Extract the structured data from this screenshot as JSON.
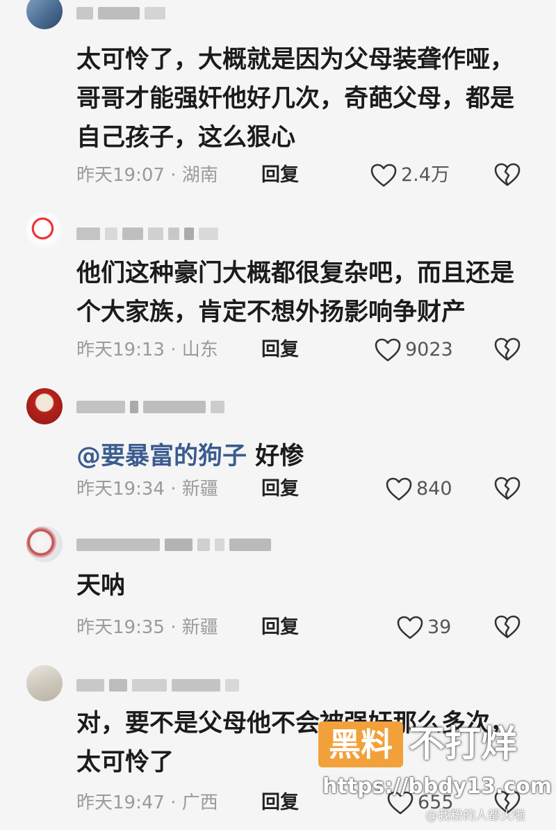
{
  "comments": [
    {
      "text": "太可怜了，大概就是因为父母装聋作哑，哥哥才能强奸他好几次，奇葩父母，都是自己孩子，这么狠心",
      "time": "昨天19:07 · 湖南",
      "reply_label": "回复",
      "likes": "2.4万"
    },
    {
      "text": "他们这种豪门大概都很复杂吧，而且还是个大家族，肯定不想外扬影响争财产",
      "time": "昨天19:13 · 山东",
      "reply_label": "回复",
      "likes": "9023"
    },
    {
      "mention": "@要暴富的狗子",
      "text": " 好惨",
      "time": "昨天19:34 · 新疆",
      "reply_label": "回复",
      "likes": "840"
    },
    {
      "text": "天呐",
      "time": "昨天19:35 · 新疆",
      "reply_label": "回复",
      "likes": "39"
    },
    {
      "text": "对，要不是父母他不会被强奸那么多次，太可怜了",
      "time": "昨天19:47 · 广西",
      "reply_label": "回复",
      "likes": "655"
    }
  ],
  "watermark": {
    "box_text": "黑料",
    "main_text": "不打烊",
    "url": "https://bbdy13.com",
    "weibo": "@我粉的人都火啦"
  },
  "icons": {
    "like": "heart-outline-icon",
    "dislike": "broken-heart-icon"
  },
  "colors": {
    "mention": "#3a5c8f",
    "meta_text": "#9a9a9a",
    "watermark_box": "#f2a03a"
  }
}
